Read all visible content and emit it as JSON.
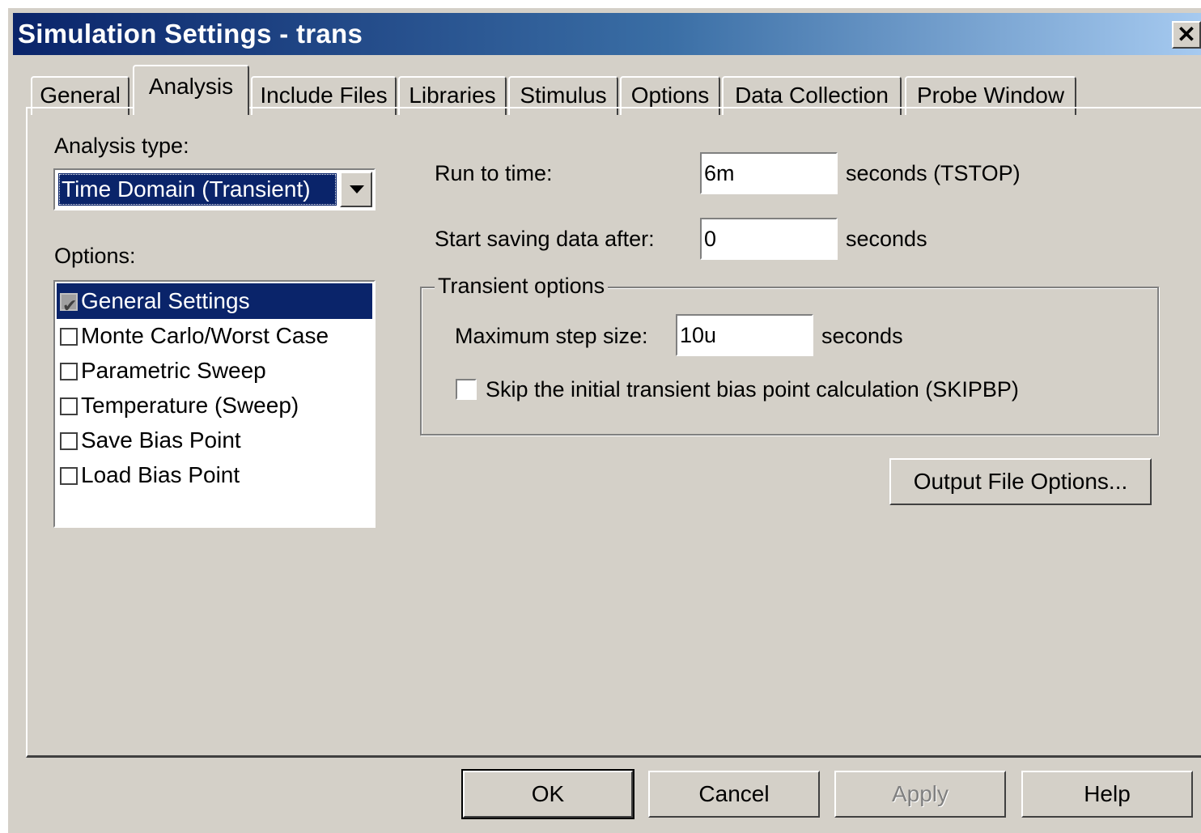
{
  "window": {
    "title": "Simulation Settings - trans",
    "close_label": "✕"
  },
  "tabs": [
    {
      "label": "General"
    },
    {
      "label": "Analysis"
    },
    {
      "label": "Include Files"
    },
    {
      "label": "Libraries"
    },
    {
      "label": "Stimulus"
    },
    {
      "label": "Options"
    },
    {
      "label": "Data Collection"
    },
    {
      "label": "Probe Window"
    }
  ],
  "active_tab": "Analysis",
  "analysis": {
    "analysis_type_label": "Analysis type:",
    "analysis_type_value": "Time Domain (Transient)",
    "options_label": "Options:",
    "options": [
      {
        "label": "General Settings",
        "checked": true,
        "selected": true
      },
      {
        "label": "Monte Carlo/Worst Case",
        "checked": false
      },
      {
        "label": "Parametric Sweep",
        "checked": false
      },
      {
        "label": "Temperature (Sweep)",
        "checked": false
      },
      {
        "label": "Save Bias Point",
        "checked": false
      },
      {
        "label": "Load Bias Point",
        "checked": false
      }
    ],
    "run_to_time_label": "Run to time:",
    "run_to_time_value": "6m",
    "run_to_time_unit": "seconds  (TSTOP)",
    "start_saving_label": "Start saving data after:",
    "start_saving_value": "0",
    "start_saving_unit": "seconds",
    "transient_group_label": "Transient options",
    "max_step_label": "Maximum step size:",
    "max_step_value": "10u",
    "max_step_unit": "seconds",
    "skip_bias_label": "Skip the initial transient bias point calculation  (SKIPBP)",
    "skip_bias_checked": false,
    "output_file_options_label": "Output File Options..."
  },
  "buttons": {
    "ok": "OK",
    "cancel": "Cancel",
    "apply": "Apply",
    "help": "Help"
  },
  "colors": {
    "dialog_bg": "#d4d0c8",
    "title_start": "#0a246a",
    "title_end": "#a6caf0",
    "selection": "#0a246a"
  }
}
